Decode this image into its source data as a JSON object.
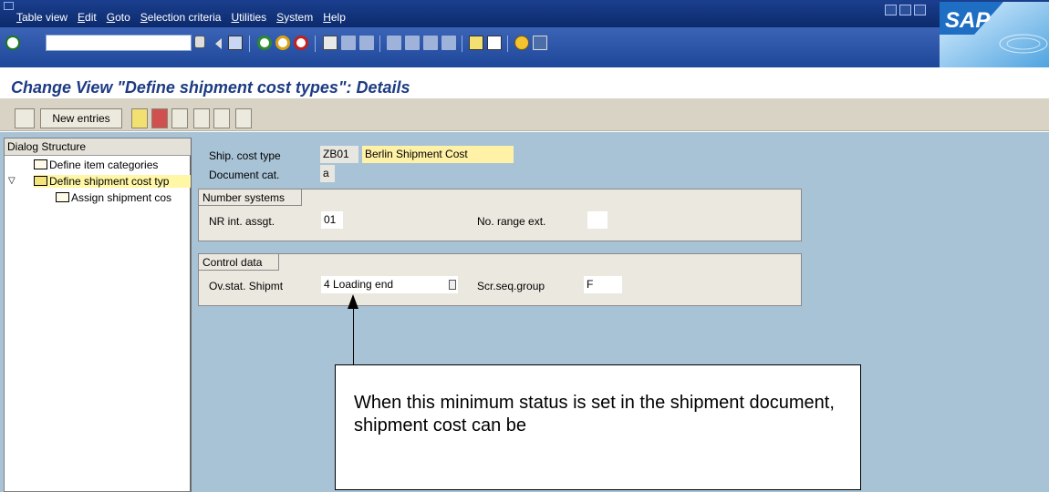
{
  "menu": {
    "items": [
      {
        "u": "T",
        "rest": "able view"
      },
      {
        "u": "E",
        "rest": "dit"
      },
      {
        "u": "G",
        "rest": "oto"
      },
      {
        "u": "S",
        "rest": "election criteria"
      },
      {
        "u": "U",
        "rest": "tilities"
      },
      {
        "u": "S",
        "rest": "ystem"
      },
      {
        "u": "H",
        "rest": "elp"
      }
    ]
  },
  "logo": {
    "text": "SAP"
  },
  "page": {
    "title": "Change View \"Define shipment cost types\": Details"
  },
  "app_toolbar": {
    "new_entries_label": "New entries"
  },
  "dialog_structure": {
    "header": "Dialog Structure",
    "items": [
      {
        "label": "Define item categories"
      },
      {
        "label": "Define shipment cost typ"
      },
      {
        "label": "Assign shipment cos"
      }
    ]
  },
  "form": {
    "ship_cost_type_label": "Ship. cost type",
    "ship_cost_type_value": "ZB01",
    "ship_cost_type_desc": "Berlin Shipment Cost",
    "document_cat_label": "Document cat.",
    "document_cat_value": "a",
    "number_systems": {
      "title": "Number systems",
      "nr_int_label": "NR int. assgt.",
      "nr_int_value": "01",
      "nr_ext_label": "No. range ext.",
      "nr_ext_value": ""
    },
    "control_data": {
      "title": "Control data",
      "ov_stat_label": "Ov.stat. Shipmt",
      "ov_stat_value": "4 Loading end",
      "scr_seq_label": "Scr.seq.group",
      "scr_seq_value": "F"
    }
  },
  "callout": {
    "text": "When this minimum status is set in the shipment document, shipment cost can be"
  },
  "colors": {
    "menubar": "#1b3f8f",
    "title": "#1d3b83",
    "main_bg": "#a8c3d6",
    "app_toolbar": "#d8d3c5"
  }
}
